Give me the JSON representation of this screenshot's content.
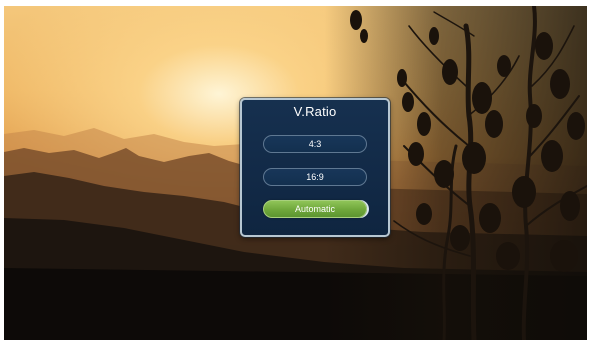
{
  "dialog": {
    "title": "V.Ratio",
    "options": [
      {
        "label": "4:3",
        "selected": false
      },
      {
        "label": "16:9",
        "selected": false
      },
      {
        "label": "Automatic",
        "selected": true
      }
    ]
  },
  "colors": {
    "dialog_background": "#122a47",
    "dialog_border": "#b7c7d2",
    "selected_option": "#6fa73b",
    "option_border": "#5f7892"
  }
}
